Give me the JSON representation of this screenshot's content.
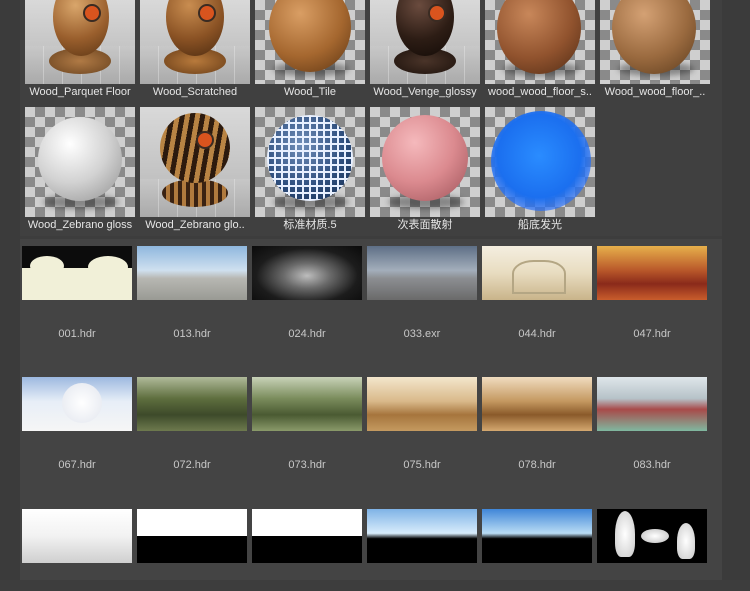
{
  "materials": [
    {
      "label": "Wood_Parquet Floor",
      "icon": "wood-sphere-on-stand"
    },
    {
      "label": "Wood_Scratched",
      "icon": "wood-sphere-on-stand"
    },
    {
      "label": "Wood_Tile",
      "icon": "wood-sphere"
    },
    {
      "label": "Wood_Venge_glossy",
      "icon": "dark-wood-sphere-on-stand"
    },
    {
      "label": "wood_wood_floor_s..",
      "icon": "wood-sphere"
    },
    {
      "label": "Wood_wood_floor_..",
      "icon": "wood-sphere"
    },
    {
      "label": "Wood_Zebrano gloss",
      "icon": "white-sphere"
    },
    {
      "label": "Wood_Zebrano glo..",
      "icon": "zebrano-sphere-on-stand"
    },
    {
      "label": "标准材质.5",
      "icon": "mosaic-sphere"
    },
    {
      "label": "次表面散射",
      "icon": "pink-sphere"
    },
    {
      "label": "船底发光",
      "icon": "glowing-blue-sphere"
    }
  ],
  "hdr_items": [
    {
      "label": "001.hdr"
    },
    {
      "label": "013.hdr"
    },
    {
      "label": "024.hdr"
    },
    {
      "label": "033.exr"
    },
    {
      "label": "044.hdr"
    },
    {
      "label": "047.hdr"
    },
    {
      "label": "067.hdr"
    },
    {
      "label": "072.hdr"
    },
    {
      "label": "073.hdr"
    },
    {
      "label": "075.hdr"
    },
    {
      "label": "078.hdr"
    },
    {
      "label": "083.hdr"
    },
    {
      "label": ""
    },
    {
      "label": ""
    },
    {
      "label": ""
    },
    {
      "label": ""
    },
    {
      "label": ""
    },
    {
      "label": ""
    }
  ],
  "colors": {
    "background": "#3d3d3d",
    "label_text": "#e6e6e6",
    "hdr_label_text": "#c8c8c8"
  }
}
